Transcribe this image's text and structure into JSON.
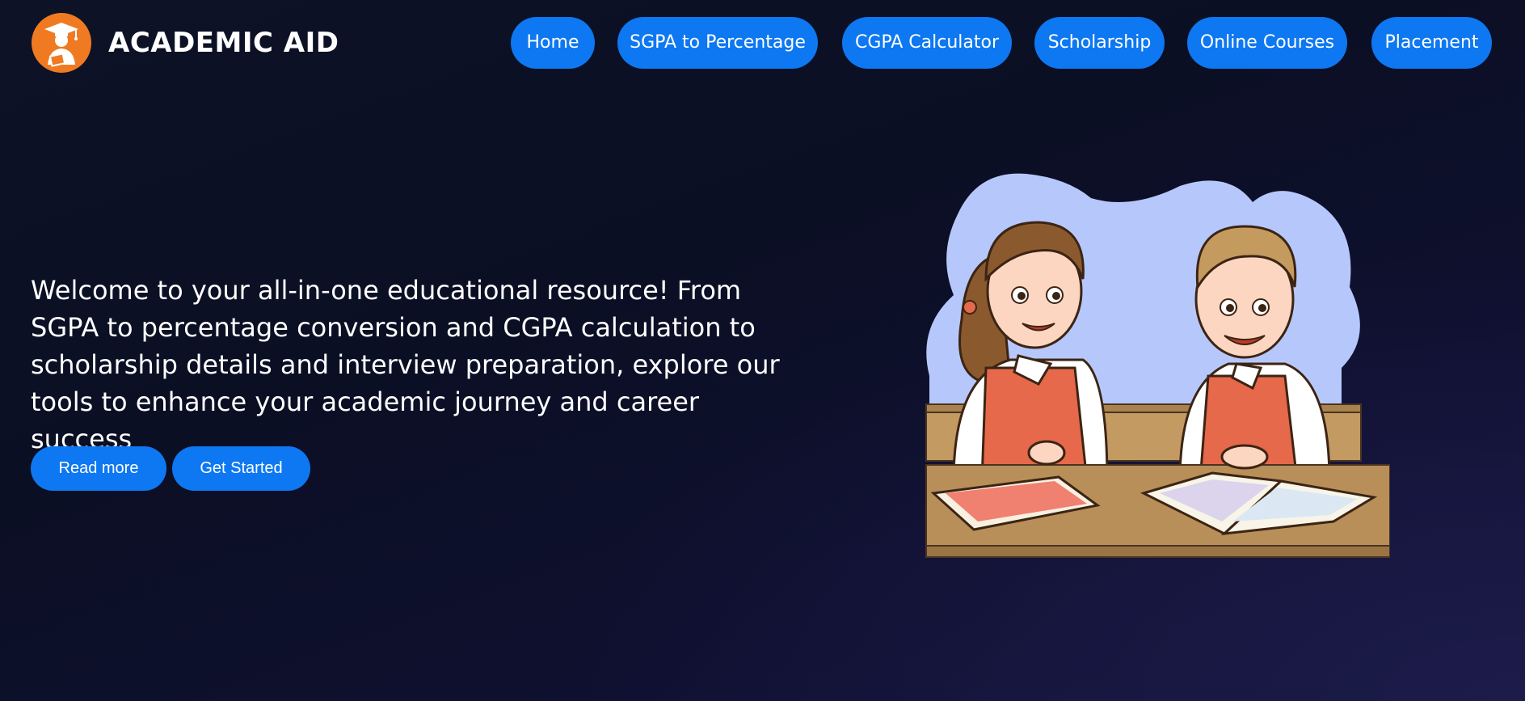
{
  "header": {
    "brand": "ACADEMIC AID",
    "logo_icon": "graduate-student-icon",
    "nav": [
      {
        "label": "Home"
      },
      {
        "label": "SGPA to Percentage"
      },
      {
        "label": "CGPA Calculator"
      },
      {
        "label": "Scholarship"
      },
      {
        "label": "Online Courses"
      },
      {
        "label": "Placement"
      }
    ]
  },
  "hero": {
    "text": "Welcome to your all-in-one educational resource! From SGPA to percentage conversion and CGPA calculation to scholarship details and interview preparation, explore our tools to enhance your academic journey and career success",
    "buttons": {
      "read_more": "Read more",
      "get_started": "Get Started"
    },
    "illustration": "two-students-studying-illustration"
  },
  "colors": {
    "accent": "#0d78f2",
    "logo_bg": "#f07a21",
    "background": "#0b0f24"
  }
}
